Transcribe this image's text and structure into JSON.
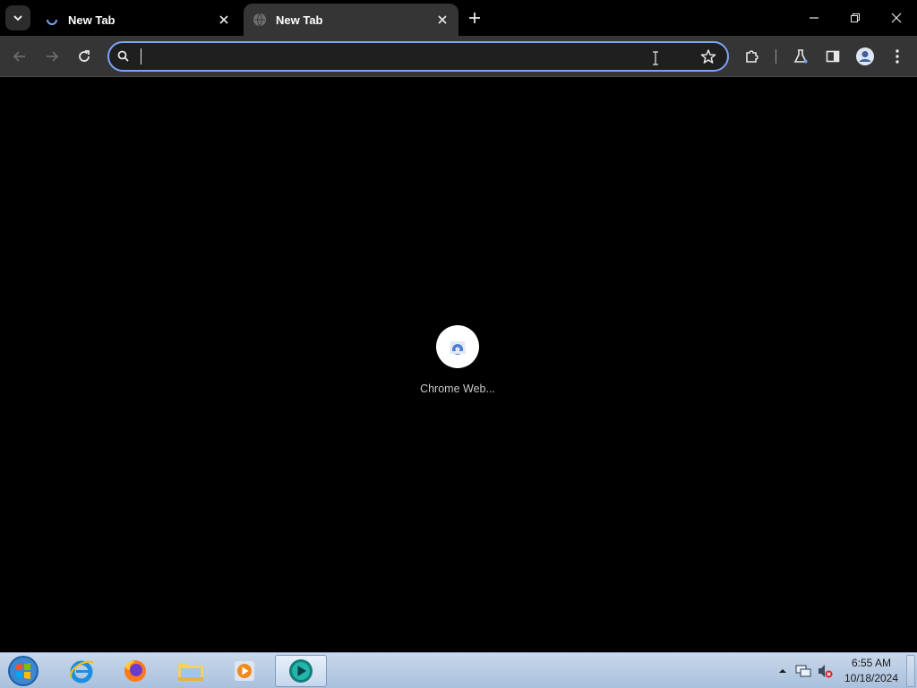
{
  "browser": {
    "tabs": [
      {
        "title": "New Tab",
        "state": "loading"
      },
      {
        "title": "New Tab",
        "state": "active"
      }
    ],
    "omnibox": {
      "value": "",
      "placeholder": ""
    },
    "accent_color": "#7ca4f5"
  },
  "content": {
    "shortcut_tile": {
      "label": "Chrome Web...",
      "icon": "chrome-web-store-icon"
    }
  },
  "taskbar": {
    "apps": [
      "start-orb",
      "internet-explorer-icon",
      "firefox-icon",
      "file-explorer-icon",
      "media-player-icon",
      "chrome-app-icon"
    ],
    "clock": {
      "time": "6:55 AM",
      "date": "10/18/2024"
    }
  }
}
